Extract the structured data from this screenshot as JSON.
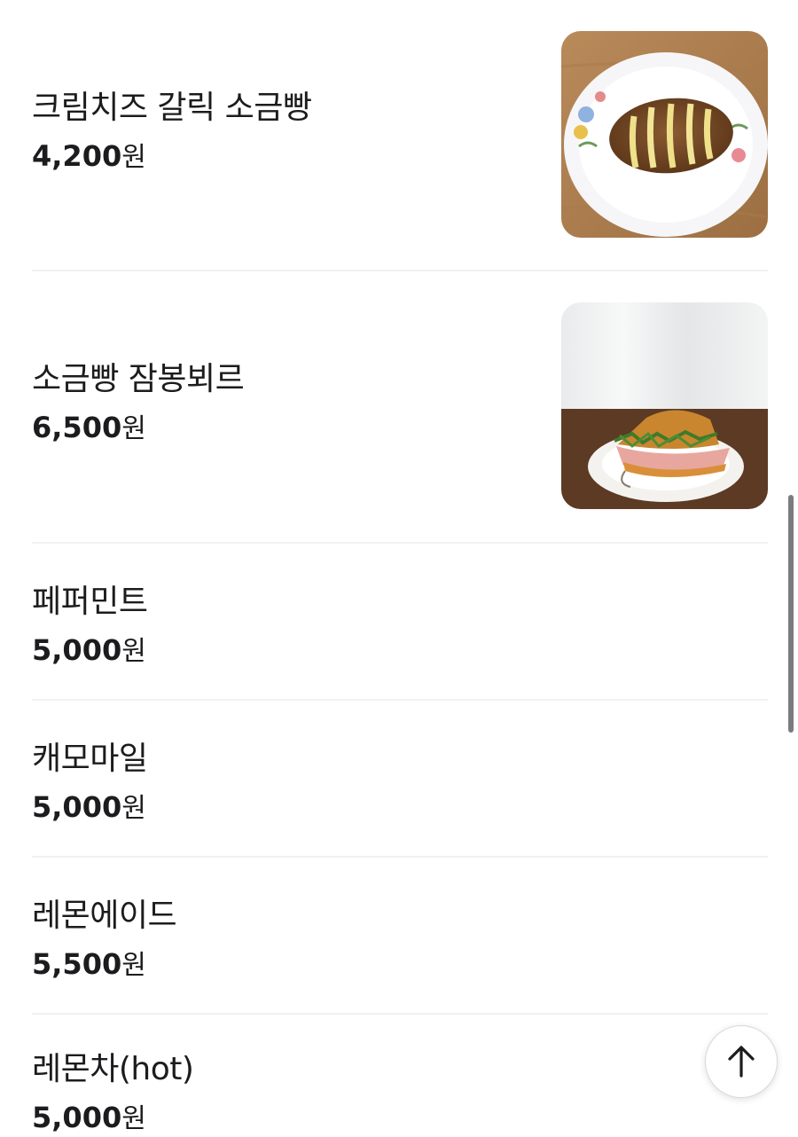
{
  "menu": {
    "items": [
      {
        "name": "크림치즈 갈릭 소금빵",
        "price": "4,200",
        "currency": "원",
        "photo": "garlic-bread-photo"
      },
      {
        "name": "소금빵 잠봉뵈르",
        "price": "6,500",
        "currency": "원",
        "photo": "jambon-sandwich-photo"
      },
      {
        "name": "페퍼민트",
        "price": "5,000",
        "currency": "원"
      },
      {
        "name": "캐모마일",
        "price": "5,000",
        "currency": "원"
      },
      {
        "name": "레몬에이드",
        "price": "5,500",
        "currency": "원"
      },
      {
        "name": "레몬차(hot)",
        "price": "5,000",
        "currency": "원"
      }
    ]
  },
  "controls": {
    "scroll_top_icon": "arrow-up-icon"
  },
  "colors": {
    "text": "#1c1c1e",
    "divider": "#f1f1f3",
    "scrollbar": "#7c7c80"
  }
}
